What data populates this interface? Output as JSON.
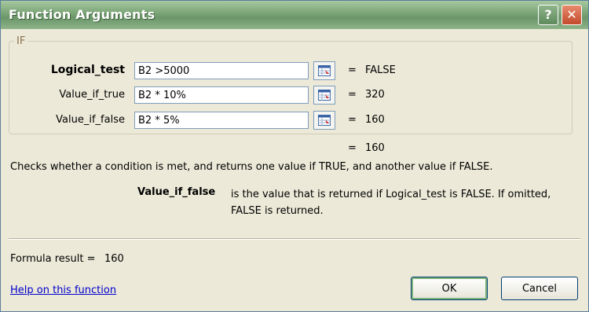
{
  "window": {
    "title": "Function Arguments",
    "help_glyph": "?",
    "close_glyph": "✕"
  },
  "function_group": {
    "name": "IF",
    "arguments": [
      {
        "label": "Logical_test",
        "value": "B2 >5000",
        "result": "FALSE"
      },
      {
        "label": "Value_if_true",
        "value": "B2 * 10%",
        "result": "320"
      },
      {
        "label": "Value_if_false",
        "value": "B2 * 5%",
        "result": "160"
      }
    ]
  },
  "equals": "=",
  "overall_result": "160",
  "function_description": "Checks whether a condition is met, and returns one value if TRUE, and another value if FALSE.",
  "current_argument": {
    "name": "Value_if_false",
    "description": "is the value that is returned if Logical_test is FALSE. If omitted, FALSE is returned."
  },
  "formula_result": {
    "label": "Formula result =",
    "value": "160"
  },
  "help_link": "Help on this function",
  "buttons": {
    "ok": "OK",
    "cancel": "Cancel"
  }
}
